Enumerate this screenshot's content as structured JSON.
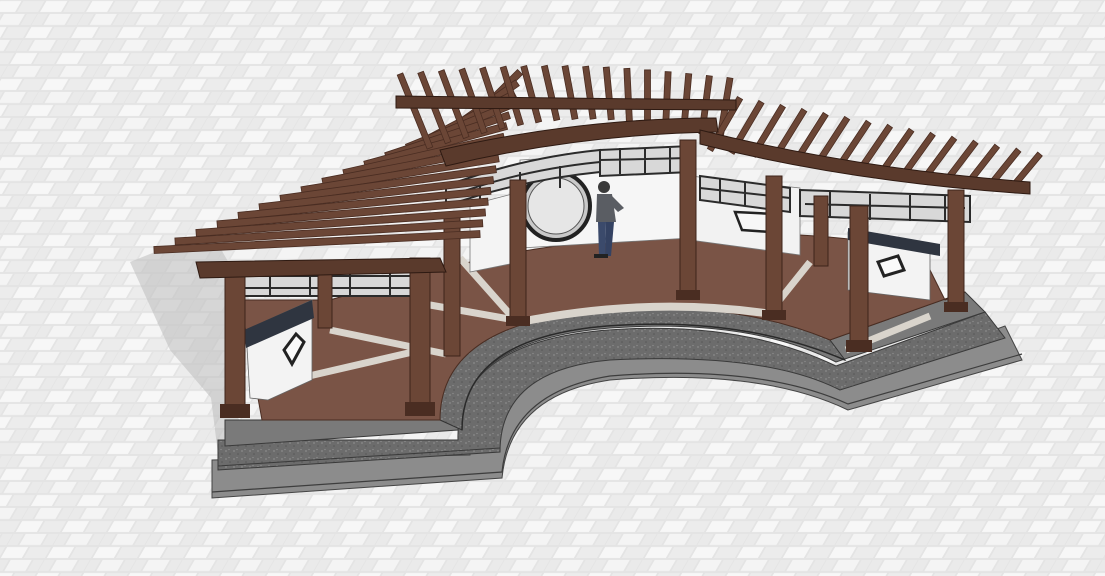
{
  "scene": {
    "colors": {
      "ground": "#e6e6e6",
      "ground_tile": "#f6f6f6",
      "ground_shadow": "#cfcfcf",
      "wood": "#6b4636",
      "wood_dark": "#4a2d22",
      "wood_light": "#8a5f4b",
      "deck": "#7a5446",
      "deck_joint": "#d9d4cc",
      "stone": "#6f6f6f",
      "stone_dark": "#4f4f4f",
      "stone_light": "#9a9a9a",
      "wall": "#f2f2f2",
      "wall_cap": "#2f3540",
      "lattice": "#2b2b2b"
    }
  }
}
